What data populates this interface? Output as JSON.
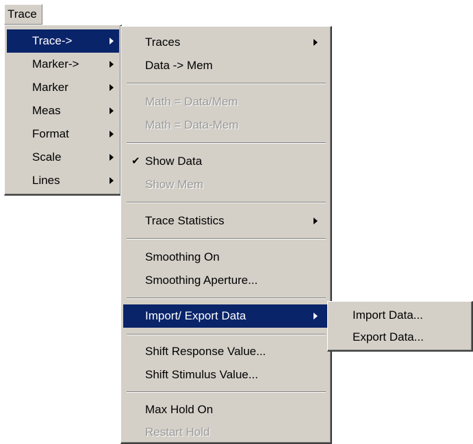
{
  "menubar": {
    "title": "Trace"
  },
  "menu_level1": {
    "items": [
      {
        "label": "Trace->"
      },
      {
        "label": "Marker->"
      },
      {
        "label": "Marker"
      },
      {
        "label": "Meas"
      },
      {
        "label": "Format"
      },
      {
        "label": "Scale"
      },
      {
        "label": "Lines"
      }
    ]
  },
  "menu_level2": {
    "items": {
      "traces": "Traces",
      "data_to_mem": "Data -> Mem",
      "math_data_div_mem": "Math = Data/Mem",
      "math_data_minus_mem": "Math = Data-Mem",
      "show_data": "Show Data",
      "show_mem": "Show Mem",
      "trace_statistics": "Trace Statistics",
      "smoothing_on": "Smoothing On",
      "smoothing_aperture": "Smoothing Aperture...",
      "import_export_data": "Import/ Export Data",
      "shift_response_value": "Shift Response Value...",
      "shift_stimulus_value": "Shift Stimulus Value...",
      "max_hold_on": "Max Hold On",
      "restart_hold": "Restart Hold"
    },
    "check_glyph": "✔"
  },
  "menu_level3": {
    "items": {
      "import_data": "Import Data...",
      "export_data": "Export Data..."
    }
  },
  "colors": {
    "menu_bg": "#d4d0c8",
    "highlight": "#0a246a",
    "disabled_text": "#9a9a9a"
  }
}
